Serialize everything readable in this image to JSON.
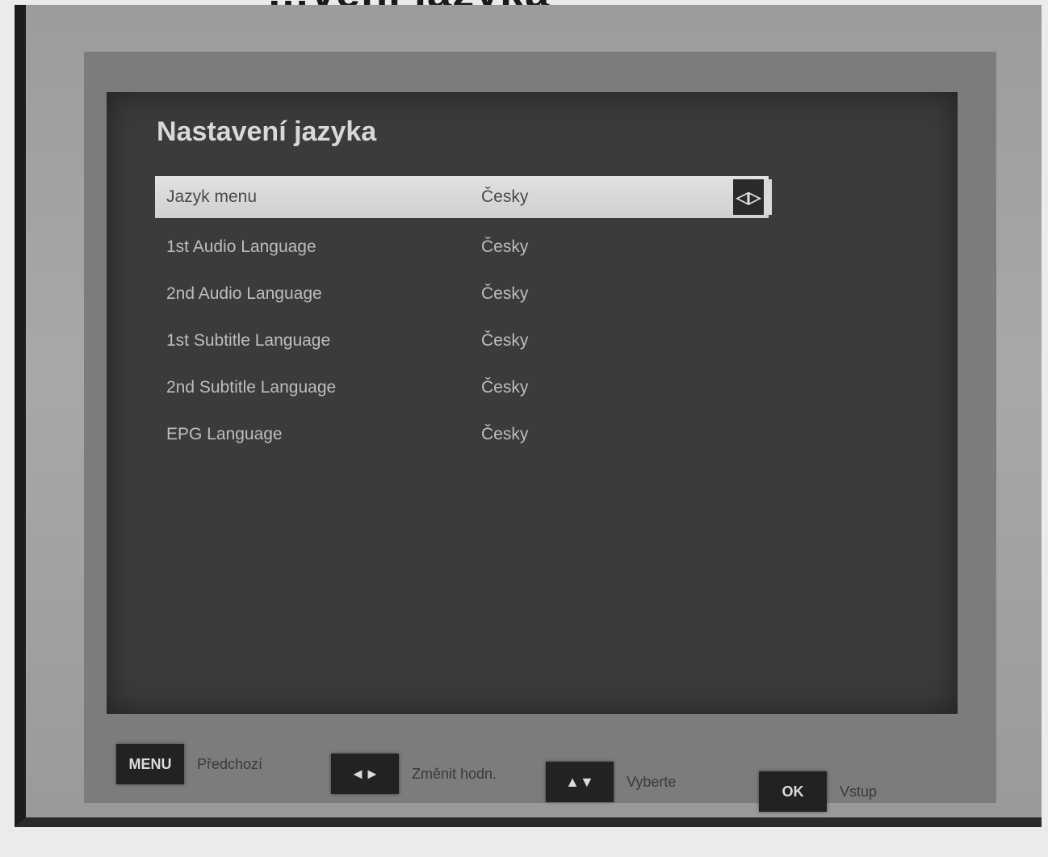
{
  "page_heading": "…vení jazyka",
  "menu": {
    "title": "Nastavení jazyka",
    "rows": [
      {
        "label": "Jazyk menu",
        "value": "Česky",
        "selected": true
      },
      {
        "label": "1st Audio Language",
        "value": "Česky",
        "selected": false
      },
      {
        "label": "2nd Audio Language",
        "value": "Česky",
        "selected": false
      },
      {
        "label": "1st Subtitle Language",
        "value": "Česky",
        "selected": false
      },
      {
        "label": "2nd Subtitle Language",
        "value": "Česky",
        "selected": false
      },
      {
        "label": "EPG Language",
        "value": "Česky",
        "selected": false
      }
    ],
    "selected_arrow_icon": "double-arrow-right-icon",
    "selected_arrow_glyph": "◁▷"
  },
  "legend": [
    {
      "key": "MENU",
      "desc": "Předchozí"
    },
    {
      "key": "◄►",
      "desc": "Změnit hodn."
    },
    {
      "key": "▲▼",
      "desc": "Vyberte"
    },
    {
      "key": "OK",
      "desc": "Vstup"
    }
  ],
  "colors": {
    "panel": "#3b3b3b",
    "selected_row": "#d8d8d8",
    "frame": "#a0a0a0"
  }
}
